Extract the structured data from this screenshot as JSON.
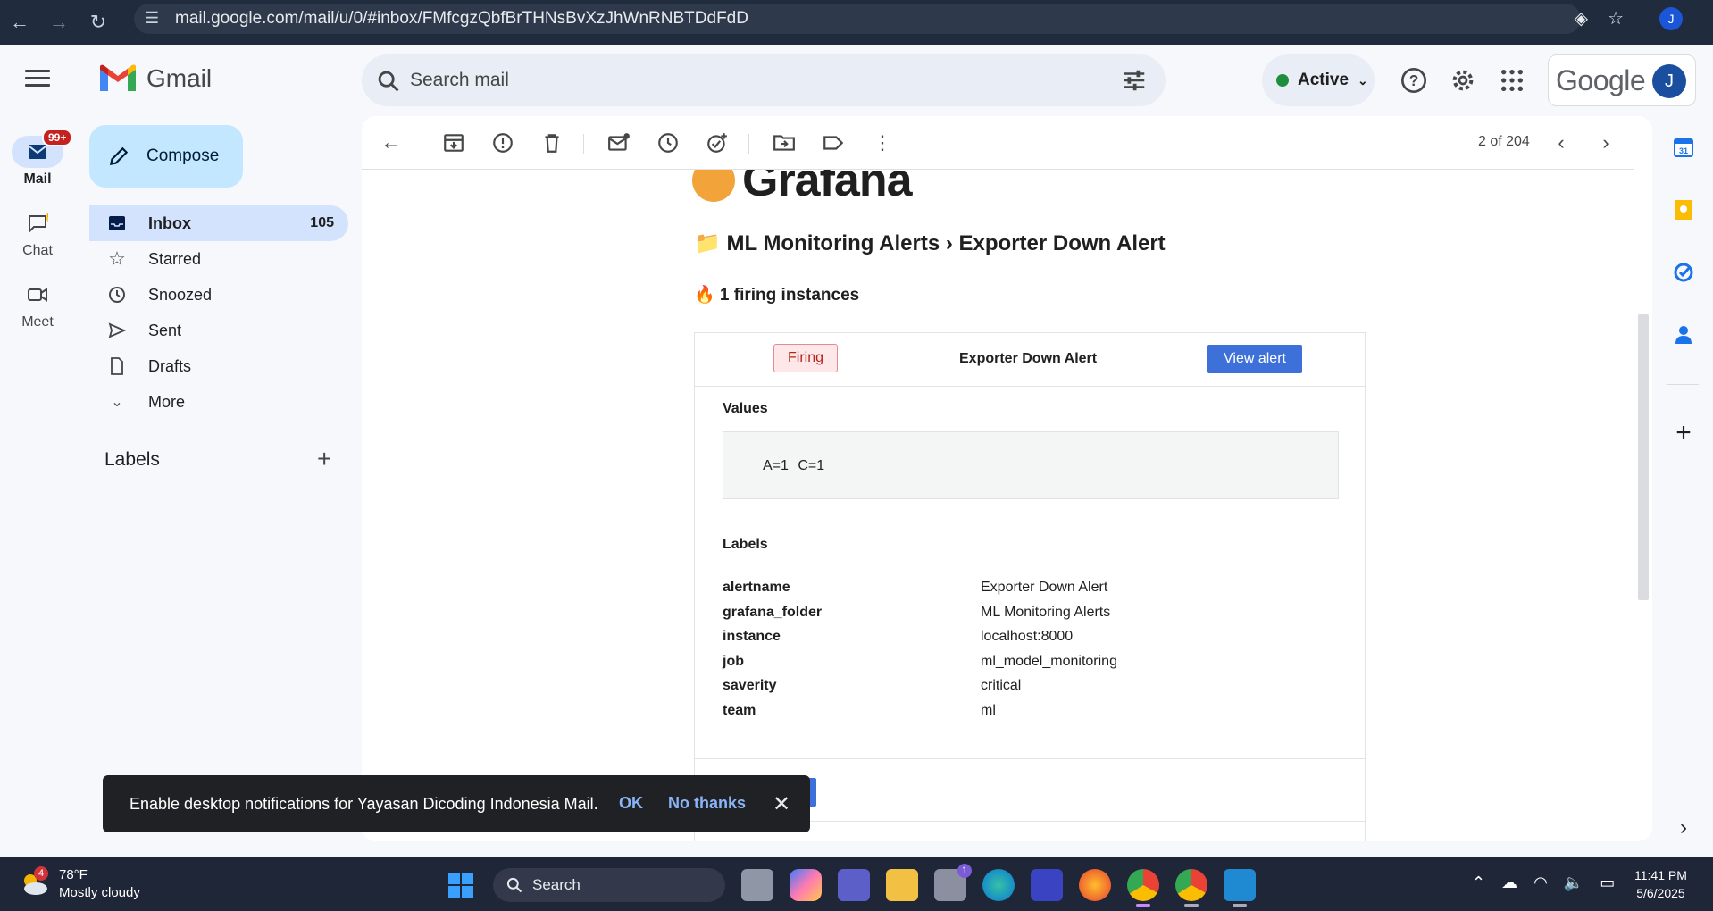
{
  "browser": {
    "url": "mail.google.com/mail/u/0/#inbox/FMfcgzQbfBrTHNsBvXzJhWnRNBTDdFdD",
    "avatar_initial": "J"
  },
  "header": {
    "app_name": "Gmail",
    "search_placeholder": "Search mail",
    "status": "Active",
    "google_word": "Google",
    "account_initial": "J"
  },
  "rail": {
    "mail_label": "Mail",
    "mail_badge": "99+",
    "chat_label": "Chat",
    "meet_label": "Meet"
  },
  "compose_label": "Compose",
  "nav": {
    "items": [
      {
        "label": "Inbox",
        "count": "105"
      },
      {
        "label": "Starred"
      },
      {
        "label": "Snoozed"
      },
      {
        "label": "Sent"
      },
      {
        "label": "Drafts"
      },
      {
        "label": "More"
      }
    ],
    "labels_heading": "Labels"
  },
  "toolbar": {
    "page_count": "2 of 204"
  },
  "email": {
    "brand_partial": "Grafana",
    "title": "📁 ML Monitoring Alerts › Exporter Down Alert",
    "firing_count": "🔥 1 firing instances",
    "card": {
      "status_badge": "Firing",
      "alert_name": "Exporter Down Alert",
      "view_button": "View alert",
      "values_heading": "Values",
      "values": "A=1 C=1",
      "labels_heading": "Labels",
      "labels": [
        {
          "key": "alertname",
          "value": "Exporter Down Alert"
        },
        {
          "key": "grafana_folder",
          "value": "ML Monitoring Alerts"
        },
        {
          "key": "instance",
          "value": "localhost:8000"
        },
        {
          "key": "job",
          "value": "ml_model_monitoring"
        },
        {
          "key": "saverity",
          "value": "critical"
        },
        {
          "key": "team",
          "value": "ml"
        }
      ]
    }
  },
  "toast": {
    "message": "Enable desktop notifications for Yayasan Dicoding Indonesia Mail.",
    "ok": "OK",
    "no_thanks": "No thanks"
  },
  "taskbar": {
    "weather_badge": "4",
    "temperature": "78°F",
    "condition": "Mostly cloudy",
    "search_label": "Search",
    "store_badge": "1",
    "time": "11:41 PM",
    "date": "5/6/2025"
  },
  "colors": {
    "accent": "#0b57d0",
    "compose_bg": "#c2e7ff",
    "selected_nav": "#d3e3fd",
    "firing_red": "#b42318",
    "view_button": "#3d71d9"
  }
}
